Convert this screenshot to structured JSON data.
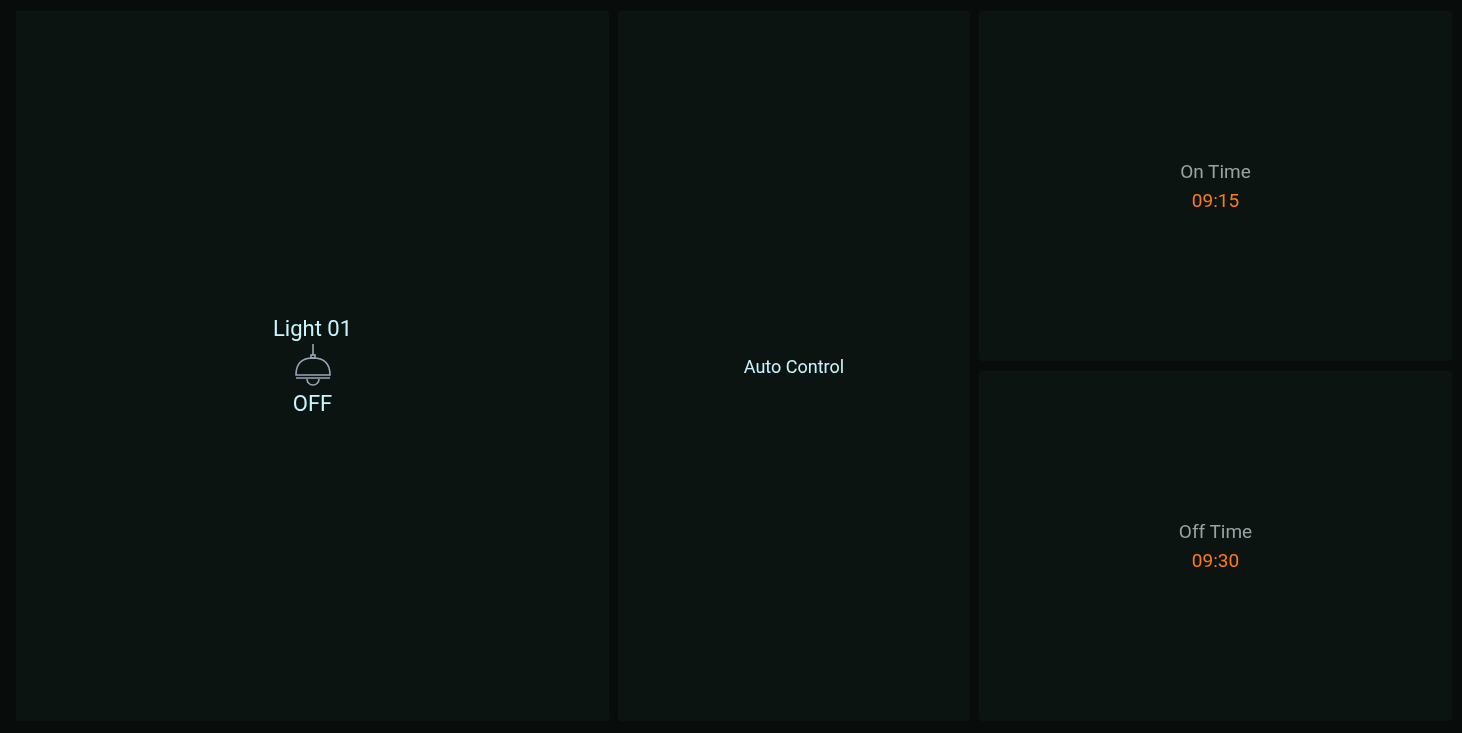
{
  "light": {
    "name": "Light 01",
    "status": "OFF",
    "on": false
  },
  "auto_control": {
    "label": "Auto Control"
  },
  "schedule": [
    {
      "label": "On Time",
      "time": "09:15"
    },
    {
      "label": "Off Time",
      "time": "09:30"
    }
  ]
}
